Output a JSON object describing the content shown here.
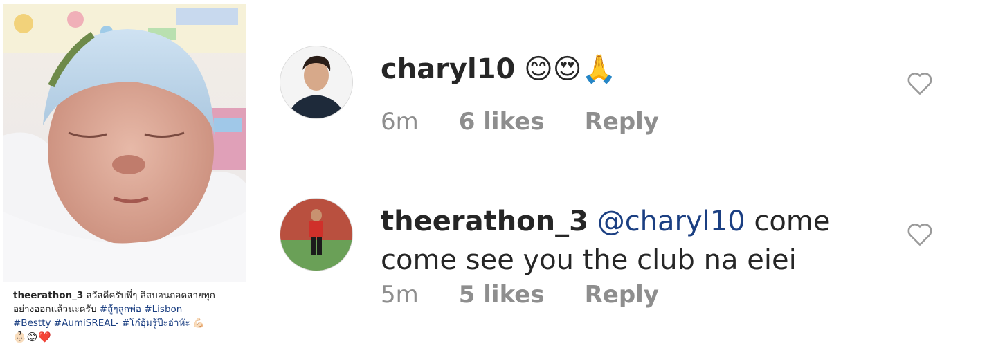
{
  "post": {
    "caption_user": "theerathon_3",
    "caption_text_1": " สวัสดีครับพี่ๆ ลิสบอนถอดสายทุก",
    "caption_text_2": "อย่างออกแล้วนะครับ ",
    "caption_tag_1": "#สู้ๆลูกพ่อ",
    "caption_tag_2": "#Lisbon",
    "caption_tag_3": "#Bestty",
    "caption_tag_4": "#AumiSREAL-",
    "caption_tag_5": "#โก๋อุ้มรู้ป๊ะอ่าหัะ",
    "caption_emoji_1": "💪🏻",
    "caption_emoji_2": "👶🏻😊❤️"
  },
  "comments": [
    {
      "username": "charyl10",
      "text": " 😊😍🙏",
      "time": "6m",
      "likes": "6 likes",
      "reply": "Reply"
    },
    {
      "username": "theerathon_3",
      "mention": "@charyl10",
      "text_1": " come",
      "text_2": "come see you the club na eiei",
      "time": "5m",
      "likes": "5 likes",
      "reply": "Reply"
    }
  ],
  "icons": {
    "heart": "heart-outline-icon"
  },
  "colors": {
    "mention": "#1b3f82",
    "meta": "#8e8e8e",
    "text": "#262626"
  }
}
